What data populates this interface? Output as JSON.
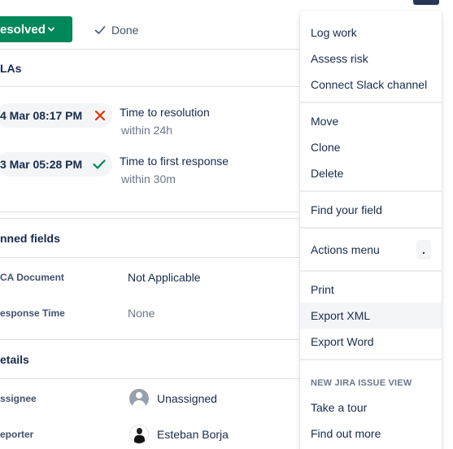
{
  "header": {
    "status_label": "esolved",
    "done_label": "Done"
  },
  "slas": {
    "title": "LAs",
    "items": [
      {
        "time": "4 Mar 08:17 PM",
        "state_icon": "cross-icon",
        "label": "Time to resolution",
        "target": "within 24h"
      },
      {
        "time": "3 Mar 05:28 PM",
        "state_icon": "check-icon",
        "label": "Time to first response",
        "target": "within 30m"
      }
    ]
  },
  "pinned": {
    "title": "nned fields",
    "fields": [
      {
        "label": "CA Document",
        "value": "Not Applicable"
      },
      {
        "label": "esponse Time",
        "value": "None"
      }
    ]
  },
  "details": {
    "title": "etails",
    "assignee_label": "ssignee",
    "assignee_value": "Unassigned",
    "reporter_label": "eporter",
    "reporter_value": "Esteban Borja"
  },
  "menu": {
    "items_group1": [
      "Log work",
      "Assess risk",
      "Connect Slack channel"
    ],
    "items_group2": [
      "Move",
      "Clone",
      "Delete"
    ],
    "find_field": "Find your field",
    "actions_menu": "Actions menu",
    "actions_shortcut": ".",
    "items_group3": [
      "Print",
      "Export XML",
      "Export Word"
    ],
    "hovered_item": "Export XML",
    "new_view_heading": "NEW JIRA ISSUE VIEW",
    "items_group4": [
      "Take a tour",
      "Find out more"
    ]
  },
  "colors": {
    "status_green": "#00875a",
    "error_red": "#de350b",
    "success_green": "#00875a",
    "text": "#172b4d",
    "muted": "#6b778c"
  }
}
